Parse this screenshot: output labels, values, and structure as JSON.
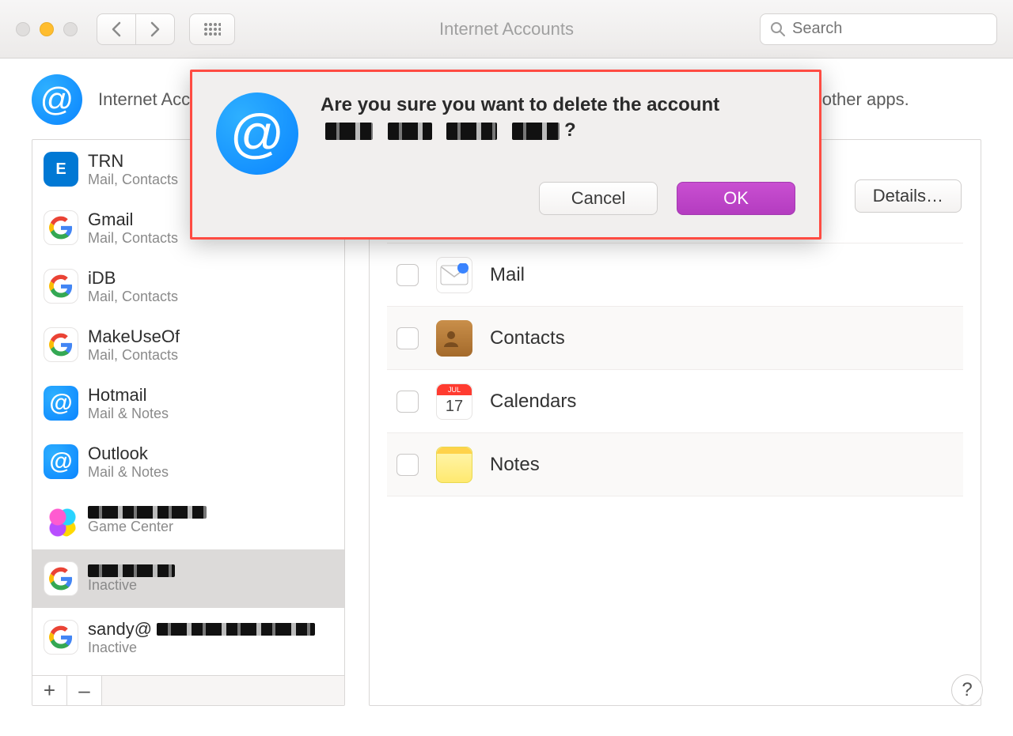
{
  "window": {
    "title": "Internet Accounts"
  },
  "toolbar": {
    "search_placeholder": "Search"
  },
  "header": {
    "description": "Internet Accounts sets up your accounts to use with Mail, Contacts, Calendar, Messages, and other apps."
  },
  "sidebar": {
    "accounts": [
      {
        "name": "TRN",
        "sub": "Mail, Contacts",
        "icon": "exchange"
      },
      {
        "name": "Gmail",
        "sub": "Mail, Contacts",
        "icon": "google"
      },
      {
        "name": "iDB",
        "sub": "Mail, Contacts",
        "icon": "google"
      },
      {
        "name": "MakeUseOf",
        "sub": "Mail, Contacts",
        "icon": "google"
      },
      {
        "name": "Hotmail",
        "sub": "Mail & Notes",
        "icon": "at"
      },
      {
        "name": "Outlook",
        "sub": "Mail & Notes",
        "icon": "at"
      },
      {
        "name": "[redacted]",
        "sub": "Game Center",
        "icon": "gamecenter",
        "name_redacted": true
      },
      {
        "name": "[redacted]",
        "sub": "Inactive",
        "icon": "google",
        "name_redacted": true,
        "selected": true
      },
      {
        "name": "sandy@",
        "sub": "Inactive",
        "icon": "google",
        "name_redacted_suffix": true
      }
    ],
    "add_label": "+",
    "remove_label": "–"
  },
  "detail": {
    "details_button": "Details…",
    "services": [
      {
        "key": "mail",
        "label": "Mail"
      },
      {
        "key": "contacts",
        "label": "Contacts"
      },
      {
        "key": "calendars",
        "label": "Calendars",
        "cal_month": "JUL",
        "cal_day": "17"
      },
      {
        "key": "notes",
        "label": "Notes"
      }
    ]
  },
  "dialog": {
    "title_prefix": "Are you sure you want to delete the account",
    "title_suffix": "?",
    "cancel": "Cancel",
    "ok": "OK"
  },
  "help_label": "?"
}
